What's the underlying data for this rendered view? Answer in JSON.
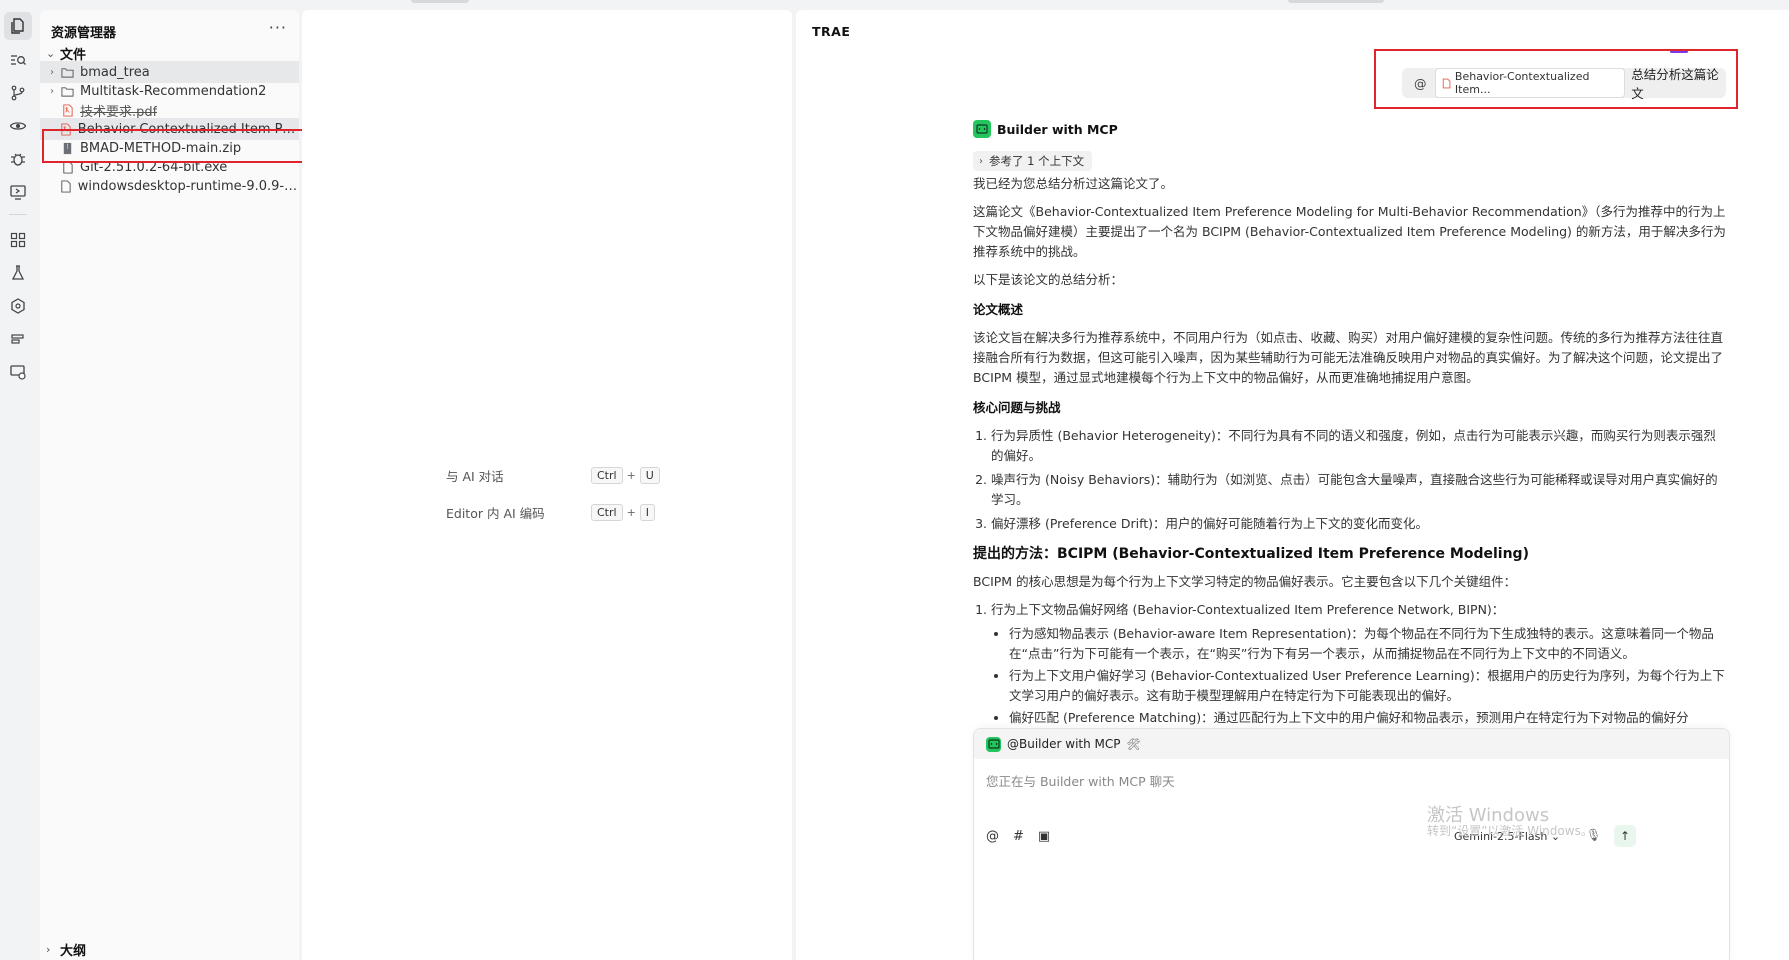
{
  "explorer": {
    "title": "资源管理器",
    "more": "···",
    "files_section": "文件",
    "outline_section": "大纲",
    "items": [
      {
        "name": "bmad_trea",
        "type": "folder"
      },
      {
        "name": "Multitask-Recommendation2",
        "type": "folder"
      },
      {
        "name": "技术要求.pdf",
        "type": "pdf"
      },
      {
        "name": "Behavior-Contextualized Item Prefer...",
        "type": "pdf"
      },
      {
        "name": "BMAD-METHOD-main.zip",
        "type": "zip"
      },
      {
        "name": "Git-2.51.0.2-64-bit.exe",
        "type": "file"
      },
      {
        "name": "windowsdesktop-runtime-9.0.9-win-...",
        "type": "file"
      }
    ]
  },
  "editor": {
    "hints": [
      {
        "label": "与 AI 对话",
        "keys": [
          "Ctrl",
          "U"
        ]
      },
      {
        "label": "Editor 内 AI 编码",
        "keys": [
          "Ctrl",
          "I"
        ]
      }
    ]
  },
  "chat": {
    "title": "TRAE",
    "user_message": {
      "at": "@",
      "file_chip": "Behavior-Contextualized Item...",
      "text": "总结分析这篇论文"
    },
    "bot_name": "Builder with MCP",
    "reference": "参考了 1 个上下文",
    "answer": {
      "p1": "我已经为您总结分析过这篇论文了。",
      "p2": "这篇论文《Behavior-Contextualized Item Preference Modeling for Multi-Behavior Recommendation》（多行为推荐中的行为上下文物品偏好建模）主要提出了一个名为 BCIPM (Behavior-Contextualized Item Preference Modeling) 的新方法，用于解决多行为推荐系统中的挑战。",
      "p3": "以下是该论文的总结分析：",
      "h_overview": "论文概述",
      "p_overview": "该论文旨在解决多行为推荐系统中，不同用户行为（如点击、收藏、购买）对用户偏好建模的复杂性问题。传统的多行为推荐方法往往直接融合所有行为数据，但这可能引入噪声，因为某些辅助行为可能无法准确反映用户对物品的真实偏好。为了解决这个问题，论文提出了 BCIPM 模型，通过显式地建模每个行为上下文中的物品偏好，从而更准确地捕捉用户意图。",
      "h_core": "核心问题与挑战",
      "core_items": [
        "行为异质性 (Behavior Heterogeneity)：不同行为具有不同的语义和强度，例如，点击行为可能表示兴趣，而购买行为则表示强烈的偏好。",
        "噪声行为 (Noisy Behaviors)：辅助行为（如浏览、点击）可能包含大量噪声，直接融合这些行为可能稀释或误导对用户真实偏好的学习。",
        "偏好漂移 (Preference Drift)：用户的偏好可能随着行为上下文的变化而变化。"
      ],
      "h_method": "提出的方法：BCIPM (Behavior-Contextualized Item Preference Modeling)",
      "p_method": "BCIPM 的核心思想是为每个行为上下文学习特定的物品偏好表示。它主要包含以下几个关键组件：",
      "method_item": "行为上下文物品偏好网络 (Behavior-Contextualized Item Preference Network, BIPN)：",
      "method_sub": [
        "行为感知物品表示 (Behavior-aware Item Representation)：为每个物品在不同行为下生成独特的表示。这意味着同一个物品在“点击”行为下可能有一个表示，在“购买”行为下有另一个表示，从而捕捉物品在不同行为上下文中的不同语义。",
        "行为上下文用户偏好学习 (Behavior-Contextualized User Preference Learning)：根据用户的历史行为序列，为每个行为上下文学习用户的偏好表示。这有助于模型理解用户在特定行为下可能表现出的偏好。",
        "偏好匹配 (Preference Matching)：通过匹配行为上下文中的用户偏好和物品表示，预测用户在特定行为下对物品的偏好分"
      ]
    },
    "input": {
      "mention": "@Builder with MCP",
      "tools_icon": "🛠",
      "placeholder": "您正在与 Builder with MCP 聊天",
      "model": "Gemini-2.5-Flash",
      "tool_at": "@",
      "tool_hash": "#",
      "tool_image": "▣"
    }
  },
  "watermark": {
    "line1": "激活 Windows",
    "line2": "转到“设置”以激活 Windows。"
  },
  "colors": {
    "accent_green": "#22c55e",
    "highlight_red": "#e0242b",
    "purple": "#7c3aed"
  }
}
